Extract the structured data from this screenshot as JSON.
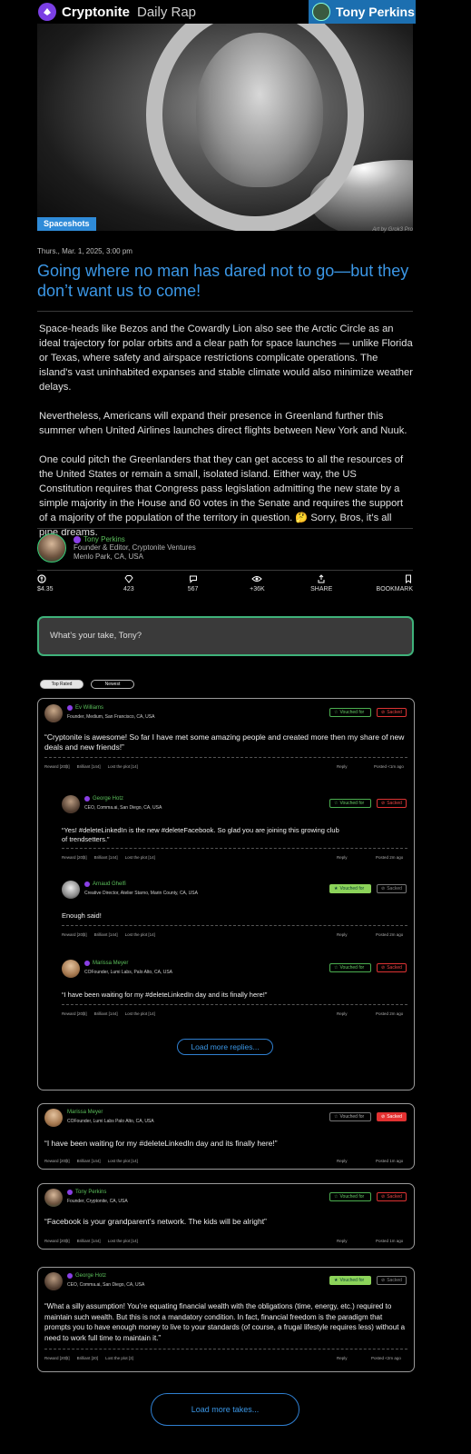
{
  "header": {
    "brand": "Cryptonite",
    "section": "Daily Rap",
    "user": "Tony Perkins"
  },
  "hero": {
    "tag": "Spaceshots",
    "credit": "Art by Grok3 Pro"
  },
  "article": {
    "date": "Thurs., Mar. 1, 2025, 3:00 pm",
    "title": "Going where no man has dared not to go—but they don’t want us to come!",
    "paragraphs": [
      "Space-heads like Bezos and the Cowardly Lion also see the Arctic Circle as an ideal trajectory for polar orbits and a clear path for space launches —        unlike Florida or Texas, where safety and airspace restrictions complicate operations. The island's vast uninhabited expanses and stable climate would also minimize weather delays.",
      "Nevertheless, Americans will expand their presence in Greenland further this summer when United Airlines launches direct flights between New York and Nuuk.",
      "One could pitch the Greenlanders that they can get access to all the resources of the United States or remain a small, isolated island. Either way, the US Constitution requires that Congress pass legislation admitting the new state by a simple majority in the House and 60 votes in the Senate and requires the support of a majority of the population of the territory in question. 🤔 Sorry, Bros, it’s all pipe dreams."
    ]
  },
  "author": {
    "name": "Tony Perkins",
    "role": "Founder & Editor, Cryptonite Ventures",
    "location": "Menlo Park, CA, USA"
  },
  "stats": {
    "tips": "$4.35",
    "gems": "423",
    "comments": "567",
    "views": "+36K",
    "share": "SHARE",
    "bookmark": "BOOKMARK"
  },
  "take_input": {
    "placeholder": "What’s your take, Tony?"
  },
  "filters": {
    "top_rated": "Top Rated",
    "newest": "Newest"
  },
  "labels": {
    "vouched": "Vouched for",
    "sacked": "Sacked",
    "reply": "Reply"
  },
  "comments": [
    {
      "name": "Ev Williams",
      "sub": "Founder, Medium, San Francisco, CA, USA",
      "text": "“Cryptonite is awesome! So far I have met some amazing people and created more then my share of new deals and new friends!”",
      "reward": "Reward [20₿]",
      "brilliant": "Brilliant [144]",
      "lost": "Lost the plot [14]",
      "posted": "Posted <1m ago"
    },
    {
      "name": "George Hotz",
      "sub": "CEO, Comma.ai, San Diego, CA, USA",
      "text": "“Yes! #deleteLinkedIn is the new #deleteFacebook. So glad you are joining this growing club of trendsetters.”",
      "reward": "Reward [20₿]",
      "brilliant": "Brilliant [144]",
      "lost": "Lost the plot [14]",
      "posted": "Posted 2m ago"
    },
    {
      "name": "Arnaud Ghelfi",
      "sub": "Creative Director, Atelier Starno, Marin County, CA, USA",
      "text": "Enough said!",
      "reward": "Reward [20₿]",
      "brilliant": "Brilliant [144]",
      "lost": "Lost the plot [14]",
      "posted": "Posted 2m ago"
    },
    {
      "name": "Marissa Meyer",
      "sub": "COFounder, Lumi Labs, Palo Alto, CA, USA",
      "text": "“I have been waiting for my #deleteLinkedIn day and its finally here!”",
      "reward": "Reward [20₿]",
      "brilliant": "Brilliant [144]",
      "lost": "Lost the plot [14]",
      "posted": "Posted 2m ago"
    },
    {
      "name": "Marissa Meyer",
      "sub": "COFounder, Lumi Labs Palo Alto, CA, USA",
      "text": "“I have been waiting for my #deleteLinkedIn day and its finally here!”",
      "reward": "Reward [20₿]",
      "brilliant": "Brilliant [144]",
      "lost": "Lost the plot [14]",
      "posted": "Posted 1m ago"
    },
    {
      "name": "Tony Perkins",
      "sub": "Founder, Cryptonite, CA, USA",
      "text": "“Facebook is your grandparent’s network. The kids will be alright”",
      "reward": "Reward [20₿]",
      "brilliant": "Brilliant [144]",
      "lost": "Lost the plot [14]",
      "posted": "Posted 1m ago"
    },
    {
      "name": "George Hotz",
      "sub": "CEO, Comma.ai, San Diego, CA, USA",
      "text": "“What a silly assumption! You’re equating financial wealth with the obligations (time, energy, etc.) required to maintain such wealth. But this is not a mandatory condition. In fact, financial freedom is the paradigm that prompts you to have enough money to live to your standards (of course, a frugal lifestyle requires less) without a need to work full time to maintain it.”",
      "reward": "Reward [20₿]",
      "brilliant": "Brilliant [20]",
      "lost": "Lost the plot [3]",
      "posted": "Posted <2m ago"
    }
  ],
  "load_replies": "Load more replies...",
  "load_takes": "Load more takes..."
}
